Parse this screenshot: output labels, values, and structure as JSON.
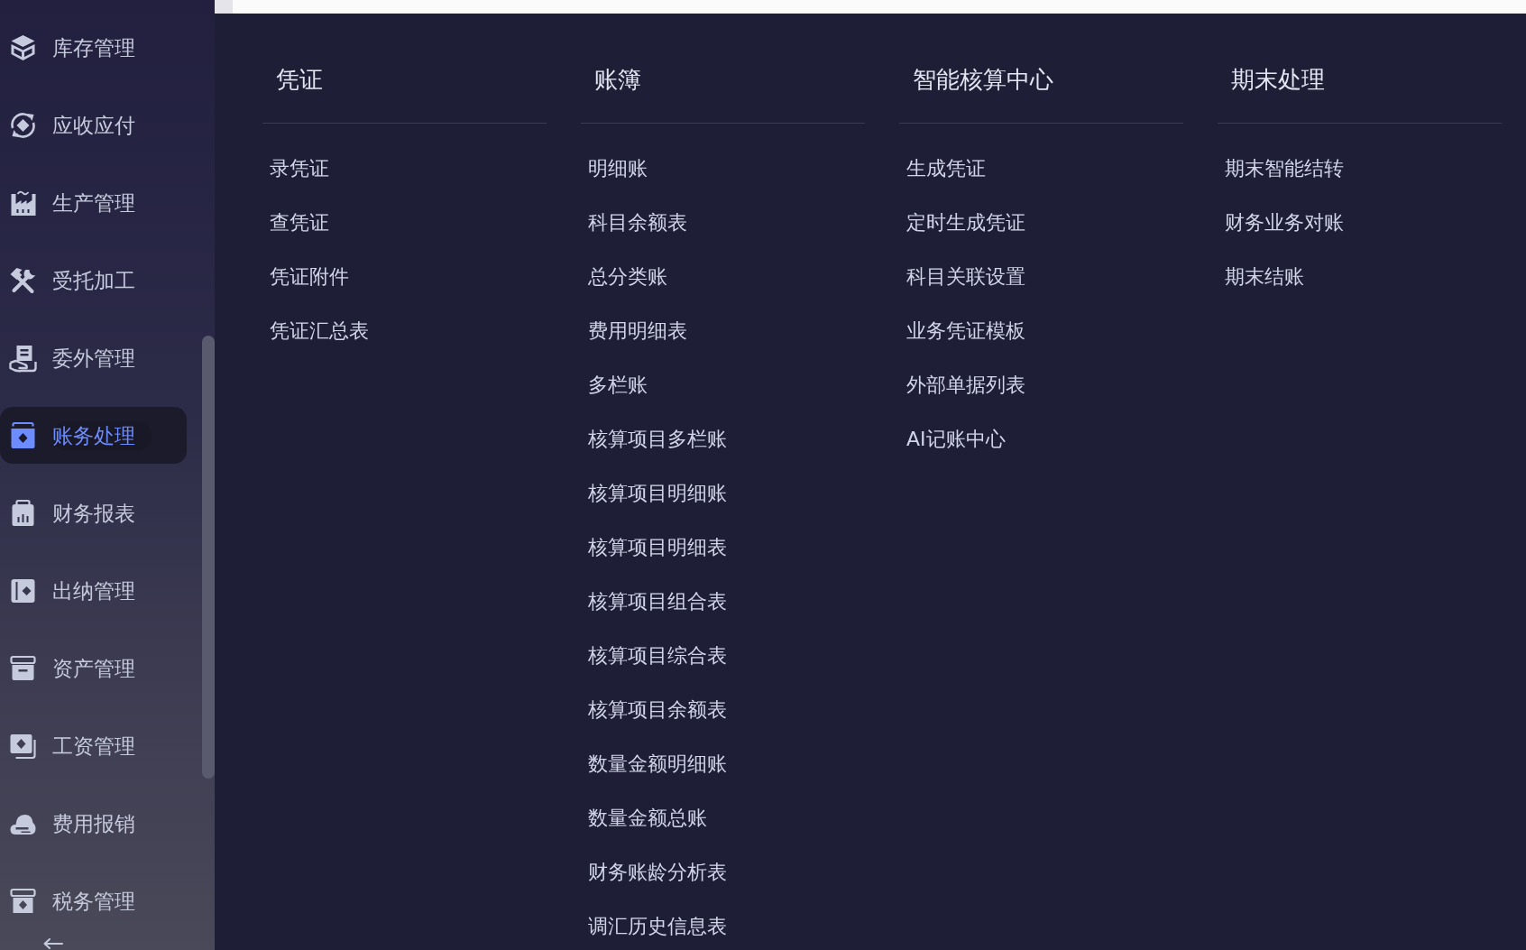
{
  "sidebar": {
    "items": [
      {
        "label": "库存管理",
        "selected": false
      },
      {
        "label": "应收应付",
        "selected": false
      },
      {
        "label": "生产管理",
        "selected": false
      },
      {
        "label": "受托加工",
        "selected": false
      },
      {
        "label": "委外管理",
        "selected": false
      },
      {
        "label": "账务处理",
        "selected": true
      },
      {
        "label": "财务报表",
        "selected": false
      },
      {
        "label": "出纳管理",
        "selected": false
      },
      {
        "label": "资产管理",
        "selected": false
      },
      {
        "label": "工资管理",
        "selected": false
      },
      {
        "label": "费用报销",
        "selected": false
      },
      {
        "label": "税务管理",
        "selected": false
      }
    ]
  },
  "menu": {
    "columns": [
      {
        "title": "凭证",
        "items": [
          "录凭证",
          "查凭证",
          "凭证附件",
          "凭证汇总表"
        ]
      },
      {
        "title": "账簿",
        "items": [
          "明细账",
          "科目余额表",
          "总分类账",
          "费用明细表",
          "多栏账",
          "核算项目多栏账",
          "核算项目明细账",
          "核算项目明细表",
          "核算项目组合表",
          "核算项目综合表",
          "核算项目余额表",
          "数量金额明细账",
          "数量金额总账",
          "财务账龄分析表",
          "调汇历史信息表"
        ]
      },
      {
        "title": "智能核算中心",
        "items": [
          "生成凭证",
          "定时生成凭证",
          "科目关联设置",
          "业务凭证模板",
          "外部单据列表",
          "AI记账中心"
        ]
      },
      {
        "title": "期末处理",
        "items": [
          "期末智能结转",
          "财务业务对账",
          "期末结账"
        ]
      }
    ]
  }
}
